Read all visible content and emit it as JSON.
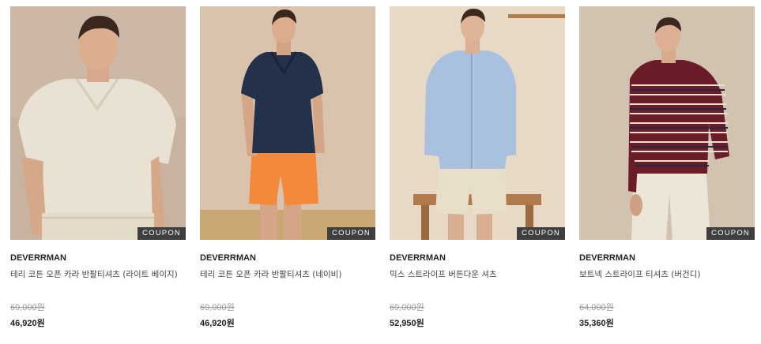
{
  "products": [
    {
      "brand": "DEVERRMAN",
      "name": "테리 코튼 오픈 카라 반팔티셔츠 (라이트 베이지)",
      "original_price": "69,000원",
      "sale_price": "46,920원",
      "badge": "COUPON",
      "colors": {
        "bg": "#c8b3a1",
        "top": "#e9e1d1",
        "bottom": "#e3dac8"
      }
    },
    {
      "brand": "DEVERRMAN",
      "name": "테리 코튼 오픈 카라 반팔티셔츠 (네이비)",
      "original_price": "69,000원",
      "sale_price": "46,920원",
      "badge": "COUPON",
      "colors": {
        "bg": "#d9c3ad",
        "top": "#24314a",
        "bottom": "#f3893a"
      }
    },
    {
      "brand": "DEVERRMAN",
      "name": "믹스 스트라이프 버튼다운 셔츠",
      "original_price": "69,000원",
      "sale_price": "52,950원",
      "badge": "COUPON",
      "colors": {
        "bg": "#e7d9c6",
        "top": "#a9c0de",
        "bottom": "#e8dfcb"
      }
    },
    {
      "brand": "DEVERRMAN",
      "name": "보트넥 스트라이프 티셔츠 (버건디)",
      "original_price": "64,000원",
      "sale_price": "35,360원",
      "badge": "COUPON",
      "colors": {
        "bg": "#d2c3b1",
        "top": "#6b1c28",
        "bottom": "#ece6d9"
      }
    }
  ]
}
